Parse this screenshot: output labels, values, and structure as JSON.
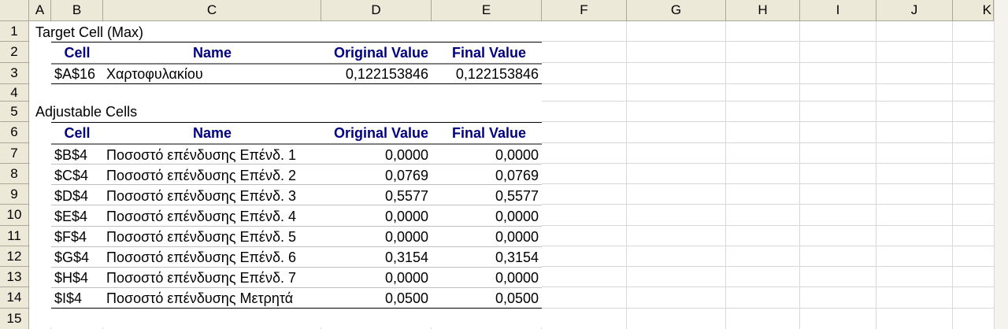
{
  "columns": [
    "A",
    "B",
    "C",
    "D",
    "E",
    "F",
    "G",
    "H",
    "I",
    "J",
    "K"
  ],
  "rows": [
    "1",
    "2",
    "3",
    "4",
    "5",
    "6",
    "7",
    "8",
    "9",
    "10",
    "11",
    "12",
    "13",
    "14",
    "15"
  ],
  "target": {
    "title": "Target Cell (Max)",
    "headers": {
      "cell": "Cell",
      "name": "Name",
      "original": "Original Value",
      "final": "Final Value"
    },
    "row": {
      "cell": "$A$16",
      "name": "Χαρτοφυλακίου",
      "original": "0,122153846",
      "final": "0,122153846"
    }
  },
  "adjustable": {
    "title": "Adjustable Cells",
    "headers": {
      "cell": "Cell",
      "name": "Name",
      "original": "Original Value",
      "final": "Final Value"
    },
    "rows": [
      {
        "cell": "$B$4",
        "name": "Ποσοστό επένδυσης Επένδ. 1",
        "original": "0,0000",
        "final": "0,0000"
      },
      {
        "cell": "$C$4",
        "name": "Ποσοστό επένδυσης Επένδ. 2",
        "original": "0,0769",
        "final": "0,0769"
      },
      {
        "cell": "$D$4",
        "name": "Ποσοστό επένδυσης Επένδ. 3",
        "original": "0,5577",
        "final": "0,5577"
      },
      {
        "cell": "$E$4",
        "name": "Ποσοστό επένδυσης Επένδ. 4",
        "original": "0,0000",
        "final": "0,0000"
      },
      {
        "cell": "$F$4",
        "name": "Ποσοστό επένδυσης Επένδ. 5",
        "original": "0,0000",
        "final": "0,0000"
      },
      {
        "cell": "$G$4",
        "name": "Ποσοστό επένδυσης Επένδ. 6",
        "original": "0,3154",
        "final": "0,3154"
      },
      {
        "cell": "$H$4",
        "name": "Ποσοστό επένδυσης Επένδ. 7",
        "original": "0,0000",
        "final": "0,0000"
      },
      {
        "cell": "$I$4",
        "name": "Ποσοστό επένδυσης Μετρητά",
        "original": "0,0500",
        "final": "0,0500"
      }
    ]
  }
}
